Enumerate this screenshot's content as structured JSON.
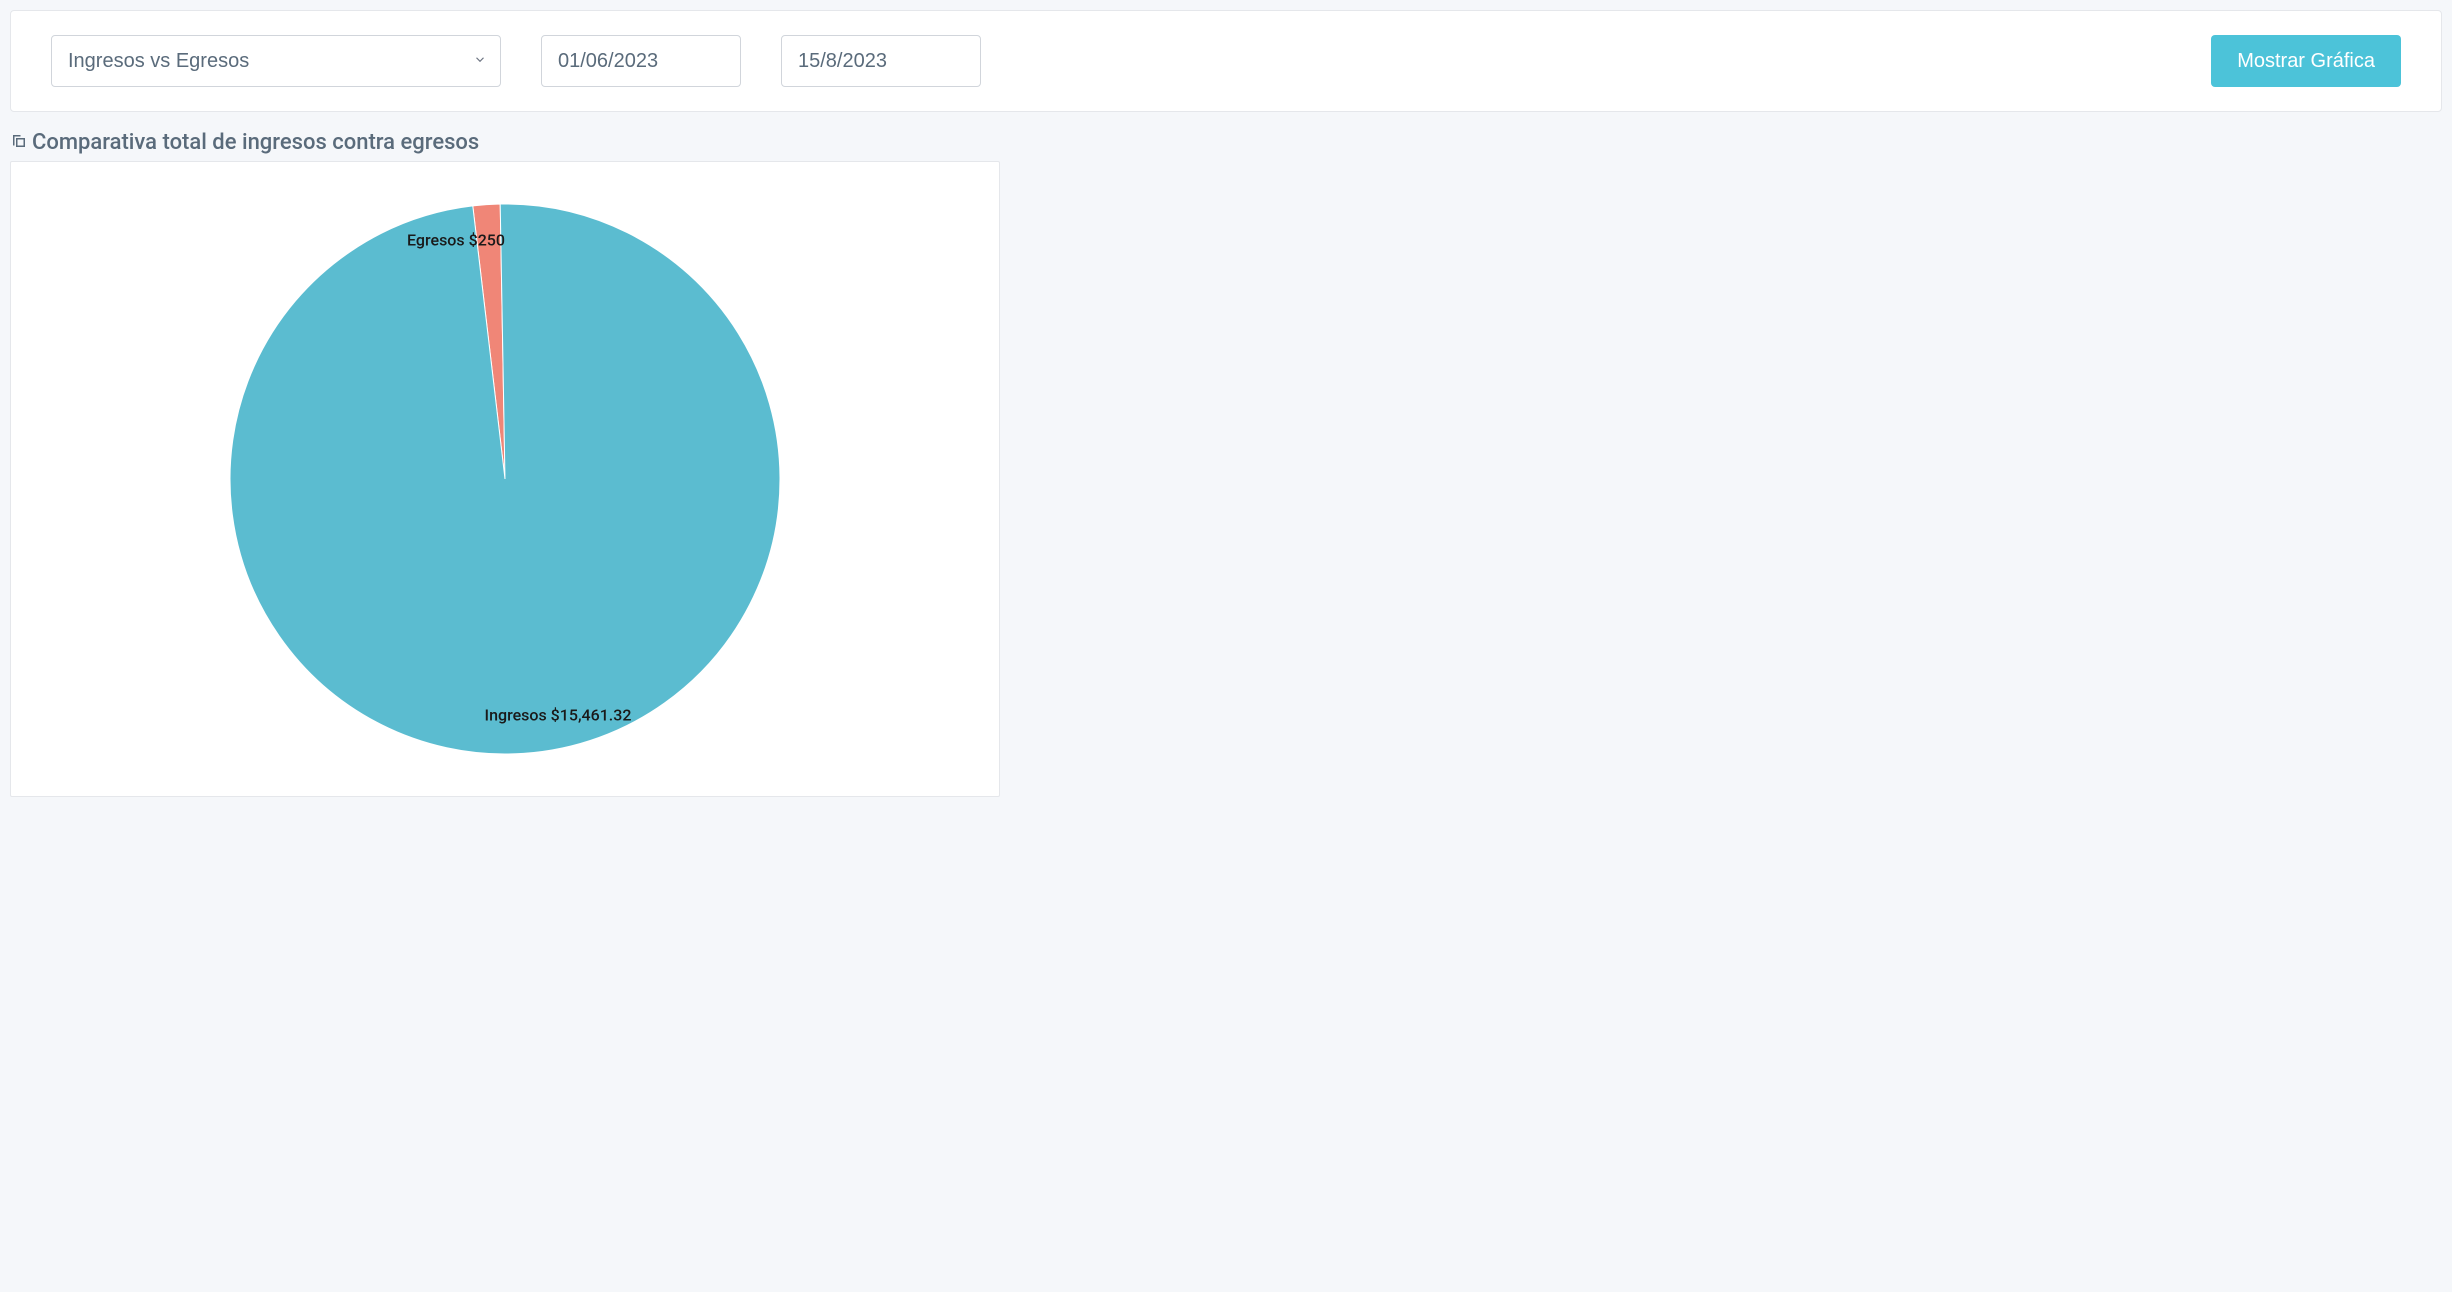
{
  "filter": {
    "select_label": "Ingresos vs Egresos",
    "date_start": "01/06/2023",
    "date_end": "15/8/2023",
    "button_label": "Mostrar Gráfica"
  },
  "chart_title": "Comparativa total de ingresos contra egresos",
  "chart_data": {
    "type": "pie",
    "title": "Comparativa total de ingresos contra egresos",
    "series": [
      {
        "name": "Ingresos",
        "value": 15461.32,
        "label": "Ingresos $15,461.32",
        "color": "#5bbcd0"
      },
      {
        "name": "Egresos",
        "value": 250,
        "label": "Egresos $250",
        "color": "#f08677"
      }
    ]
  }
}
